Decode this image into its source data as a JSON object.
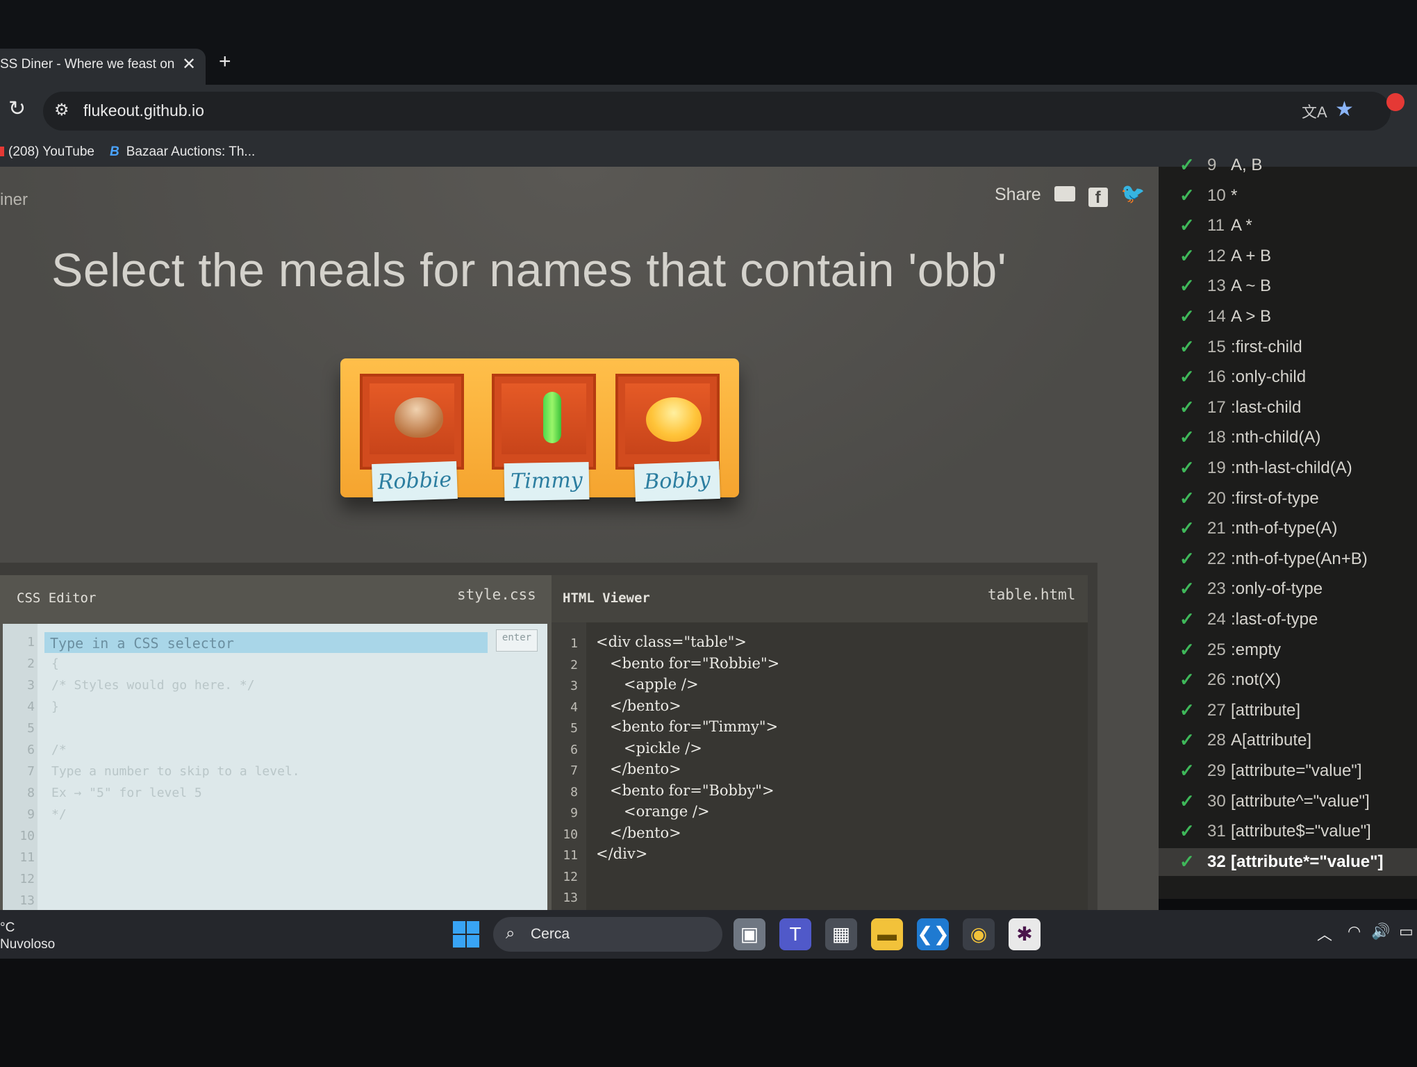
{
  "browser": {
    "tab_title": "SS Diner - Where we feast on",
    "tab_close": "✕",
    "new_tab": "+",
    "url": "flukeout.github.io",
    "bookmarks": [
      "(208) YouTube",
      "Bazaar Auctions: Th..."
    ],
    "bookmark_badge": "B"
  },
  "page": {
    "site_name": "iner",
    "share_label": "Share",
    "headline": "Select the meals for names that contain 'obb'",
    "bentos": [
      {
        "name": "Robbie",
        "food": "apple"
      },
      {
        "name": "Timmy",
        "food": "pickle"
      },
      {
        "name": "Bobby",
        "food": "orange"
      }
    ]
  },
  "css_editor": {
    "title": "CSS Editor",
    "file": "style.css",
    "placeholder": "Type in a CSS selector",
    "enter_label": "enter",
    "line_numbers": [
      "1",
      "2",
      "3",
      "4",
      "5",
      "6",
      "7",
      "8",
      "9",
      "10",
      "11",
      "12",
      "13"
    ],
    "lines": [
      "",
      "{",
      "/* Styles would go here. */",
      "}",
      "",
      "/*",
      "Type a number to skip to a level.",
      "Ex → \"5\" for level 5",
      "*/",
      "",
      "",
      "",
      ""
    ]
  },
  "html_viewer": {
    "title": "HTML Viewer",
    "file": "table.html",
    "line_numbers": [
      "1",
      "2",
      "3",
      "4",
      "5",
      "6",
      "7",
      "8",
      "9",
      "10",
      "11",
      "12",
      "13"
    ],
    "lines": [
      "<div class=\"table\">",
      "   <bento for=\"Robbie\">",
      "      <apple />",
      "   </bento>",
      "   <bento for=\"Timmy\">",
      "      <pickle />",
      "   </bento>",
      "   <bento for=\"Bobby\">",
      "      <orange />",
      "   </bento>",
      "</div>",
      "",
      ""
    ]
  },
  "levels": [
    {
      "num": "9",
      "selector": "A, B"
    },
    {
      "num": "10",
      "selector": "*"
    },
    {
      "num": "11",
      "selector": "A *"
    },
    {
      "num": "12",
      "selector": "A + B"
    },
    {
      "num": "13",
      "selector": "A ~ B"
    },
    {
      "num": "14",
      "selector": "A > B"
    },
    {
      "num": "15",
      "selector": ":first-child"
    },
    {
      "num": "16",
      "selector": ":only-child"
    },
    {
      "num": "17",
      "selector": ":last-child"
    },
    {
      "num": "18",
      "selector": ":nth-child(A)"
    },
    {
      "num": "19",
      "selector": ":nth-last-child(A)"
    },
    {
      "num": "20",
      "selector": ":first-of-type"
    },
    {
      "num": "21",
      "selector": ":nth-of-type(A)"
    },
    {
      "num": "22",
      "selector": ":nth-of-type(An+B)"
    },
    {
      "num": "23",
      "selector": ":only-of-type"
    },
    {
      "num": "24",
      "selector": ":last-of-type"
    },
    {
      "num": "25",
      "selector": ":empty"
    },
    {
      "num": "26",
      "selector": ":not(X)"
    },
    {
      "num": "27",
      "selector": "[attribute]"
    },
    {
      "num": "28",
      "selector": "A[attribute]"
    },
    {
      "num": "29",
      "selector": "[attribute=\"value\"]"
    },
    {
      "num": "30",
      "selector": "[attribute^=\"value\"]"
    },
    {
      "num": "31",
      "selector": "[attribute$=\"value\"]"
    },
    {
      "num": "32",
      "selector": "[attribute*=\"value\"]"
    }
  ],
  "current_level": "32",
  "taskbar": {
    "weather_temp": "°C",
    "weather_desc": "Nuvoloso",
    "search_placeholder": "Cerca"
  },
  "colors": {
    "check": "#3fb85a",
    "page_bg": "#4c4b48",
    "table": "#f5a42f",
    "nametag_text": "#2c7ea0"
  }
}
